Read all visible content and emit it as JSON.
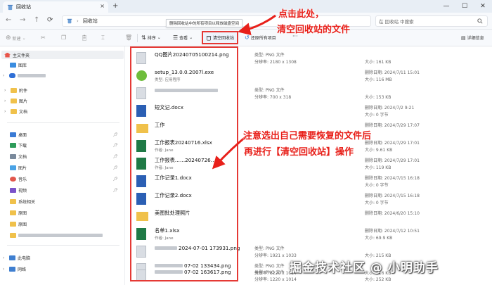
{
  "window": {
    "tab_title": "回收站",
    "tab_icon": "recycle-bin-icon",
    "controls": [
      "—",
      "☐",
      "✕"
    ]
  },
  "address_bar": {
    "path": "回收站",
    "search_placeholder": "在 回收站 中搜索"
  },
  "toolbar": {
    "new_label": "新建",
    "sort_label": "排序",
    "view_label": "查看",
    "empty_label": "清空回收站",
    "restore_all_label": "还原所有项目",
    "more_label": "···",
    "details_label": "详细信息",
    "tooltip": "删除回收站中的所有项目以释放磁盘空间"
  },
  "sidebar": {
    "items": [
      {
        "label": "主文件夹",
        "icon": "home-icon",
        "selected": true
      },
      {
        "label": "图库",
        "icon": "gallery-icon"
      },
      {
        "label": "",
        "icon": "cloud-icon",
        "blurred": true
      },
      {
        "label": "附件",
        "icon": "folder-icon",
        "expandable": true
      },
      {
        "label": "图片",
        "icon": "folder-icon",
        "expandable": true
      },
      {
        "label": "文档",
        "icon": "folder-icon",
        "expandable": true
      },
      {
        "label": "桌面",
        "icon": "desktop-icon",
        "pinned": true
      },
      {
        "label": "下载",
        "icon": "download-icon",
        "pinned": true
      },
      {
        "label": "文档",
        "icon": "documents-icon",
        "pinned": true
      },
      {
        "label": "图片",
        "icon": "pictures-icon",
        "pinned": true
      },
      {
        "label": "音乐",
        "icon": "music-icon",
        "pinned": true
      },
      {
        "label": "视频",
        "icon": "video-icon",
        "pinned": true
      },
      {
        "label": "系统相关",
        "icon": "folder-icon"
      },
      {
        "label": "原图",
        "icon": "folder-icon"
      },
      {
        "label": "原图",
        "icon": "folder-icon"
      },
      {
        "label": "",
        "icon": "folder-icon",
        "blurred": true
      },
      {
        "label": "此电脑",
        "icon": "pc-icon",
        "expandable": true
      },
      {
        "label": "网络",
        "icon": "network-icon",
        "expandable": true
      }
    ]
  },
  "files": [
    {
      "name": "QQ图片20240705100214.png",
      "icon": "image-file-icon",
      "sub": "",
      "a1": "类型: PNG 文件",
      "a2": "分辨率: 2180 x 1308",
      "b1": "",
      "b2": "大小: 161 KB"
    },
    {
      "name": "setup_13.0.0.2007l.exe",
      "icon": "installer-icon",
      "sub": "类型: 应用程序",
      "a1": "",
      "a2": "",
      "b1": "删除日期: 2024/7/11 15:01",
      "b2": "大小: 116 MB"
    },
    {
      "name": "",
      "icon": "image-file-icon",
      "sub": "",
      "a1": "类型: PNG 文件",
      "a2": "分辨率: 700 x 318",
      "b1": "",
      "b2": "大小: 153 KB",
      "blur_name": true
    },
    {
      "name": "短文记.docx",
      "icon": "word-icon",
      "sub": "",
      "a1": "",
      "a2": "",
      "b1": "删除日期: 2024/7/2 9:21",
      "b2": "大小: 0 字节"
    },
    {
      "name": "工作",
      "icon": "folder-icon",
      "sub": "",
      "a1": "",
      "a2": "",
      "b1": "删除日期: 2024/7/29 17:07",
      "b2": ""
    },
    {
      "name": "工作报表20240716.xlsx",
      "icon": "excel-icon",
      "sub": "作者: Jane",
      "a1": "",
      "a2": "",
      "b1": "删除日期: 2024/7/29 17:01",
      "b2": "大小: 9.61 KB"
    },
    {
      "name": "工作报表……20240726……",
      "icon": "excel-icon",
      "sub": "作者: Jane",
      "a1": "",
      "a2": "",
      "b1": "删除日期: 2024/7/29 17:01",
      "b2": "大小: 119 KB"
    },
    {
      "name": "工作记录1.docx",
      "icon": "word-icon",
      "sub": "",
      "a1": "",
      "a2": "",
      "b1": "删除日期: 2024/7/15 16:18",
      "b2": "大小: 0 字节"
    },
    {
      "name": "工作记录2.docx",
      "icon": "word-icon",
      "sub": "",
      "a1": "",
      "a2": "",
      "b1": "删除日期: 2024/7/15 16:18",
      "b2": "大小: 0 字节"
    },
    {
      "name": "美图批处理照片",
      "icon": "folder-icon",
      "sub": "",
      "a1": "",
      "a2": "",
      "b1": "删除日期: 2024/6/20 15:10",
      "b2": ""
    },
    {
      "name": "名单1.xlsx",
      "icon": "excel-icon",
      "sub": "作者: Jane",
      "a1": "",
      "a2": "",
      "b1": "删除日期: 2024/7/12 10:51",
      "b2": "大小: 69.9 KB"
    },
    {
      "name": "2024-07-01 173931.png",
      "icon": "image-file-icon",
      "sub": "",
      "a1": "类型: PNG 文件",
      "a2": "分辨率: 1921 x 1033",
      "b1": "",
      "b2": "大小: 215 KB",
      "blur_prefix": true
    },
    {
      "name": "07-02 133434.png",
      "icon": "image-file-icon",
      "sub": "",
      "a1": "类型: PNG 文件",
      "a2": "分辨率: 1220 x 1014",
      "b1": "",
      "b2": "大小: 216 KB",
      "blur_prefix": true
    },
    {
      "name": "07-02 163617.png",
      "icon": "image-file-icon",
      "sub": "",
      "a1": "类型: PNG 文件",
      "a2": "分辨率: 1220 x 1014",
      "b1": "",
      "b2": "大小: 252 KB",
      "blur_prefix": true
    }
  ],
  "annotations": {
    "top_line1": "点击此处，",
    "top_line2": "清空回收站的文件",
    "mid_line1": "注意选出自己需要恢复的文件后",
    "mid_line2": "再进行【清空回收站】操作",
    "color": "#e8201a"
  },
  "watermark": "掘金技术社区 @ 小明助手"
}
